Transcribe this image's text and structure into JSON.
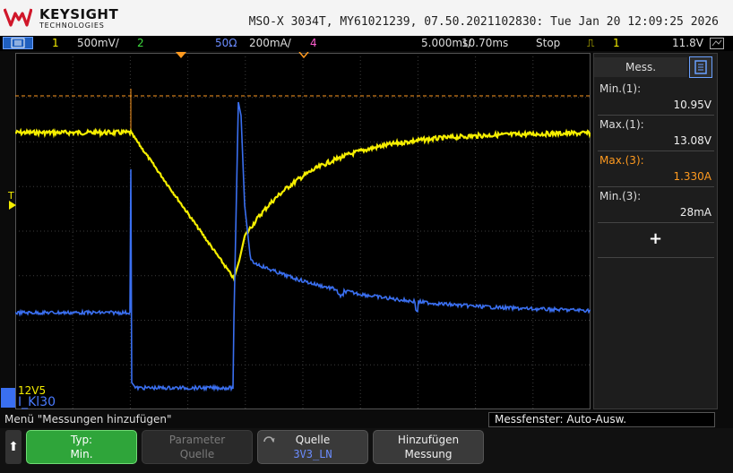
{
  "header": {
    "brand": "KEYSIGHT",
    "brand_sub": "TECHNOLOGIES",
    "title": "MSO-X 3034T, MY61021239, 07.50.2021102830: Tue Jan 20 12:09:25 2026"
  },
  "status": {
    "ch1_num": "1",
    "ch1_scale": "500mV/",
    "ch2_num": "2",
    "ch3_imp": "50Ω",
    "ch3_scale": "200mA/",
    "ch4_num": "4",
    "timebase": "5.000ms/",
    "delay": "10.70ms",
    "run_state": "Stop",
    "trig_ch": "1",
    "trig_level": "11.8V"
  },
  "screen": {
    "ref_label": "12V5",
    "ch3_label": "I_Kl30",
    "trigger_marker": "T"
  },
  "panel": {
    "title": "Mess.",
    "measurements": [
      {
        "label": "Min.(1):",
        "value": "10.95V",
        "color": "#dddddd"
      },
      {
        "label": "Max.(1):",
        "value": "13.08V",
        "color": "#dddddd"
      },
      {
        "label": "Max.(3):",
        "value": "1.330A",
        "color": "#ff9a1f"
      },
      {
        "label": "Min.(3):",
        "value": "28mA",
        "color": "#dddddd"
      }
    ],
    "add_symbol": "+"
  },
  "bottom": {
    "menu_hint": "Menü \"Messungen hinzufügen\"",
    "window_hint": "Messfenster: Auto-Ausw.",
    "back_symbol": "⬆",
    "softkeys": [
      {
        "line1": "Typ:",
        "line2": "Min."
      },
      {
        "line1": "Parameter",
        "line2": "Quelle"
      },
      {
        "line1": "Quelle",
        "line2": "3V3_LN"
      },
      {
        "line1": "Hinzufügen",
        "line2": "Messung"
      }
    ]
  },
  "colors": {
    "ch1": "#f5ee00",
    "ch3": "#3a6ff0",
    "accent_orange": "#ff9a1f",
    "softkey_active": "#2fa53a"
  }
}
